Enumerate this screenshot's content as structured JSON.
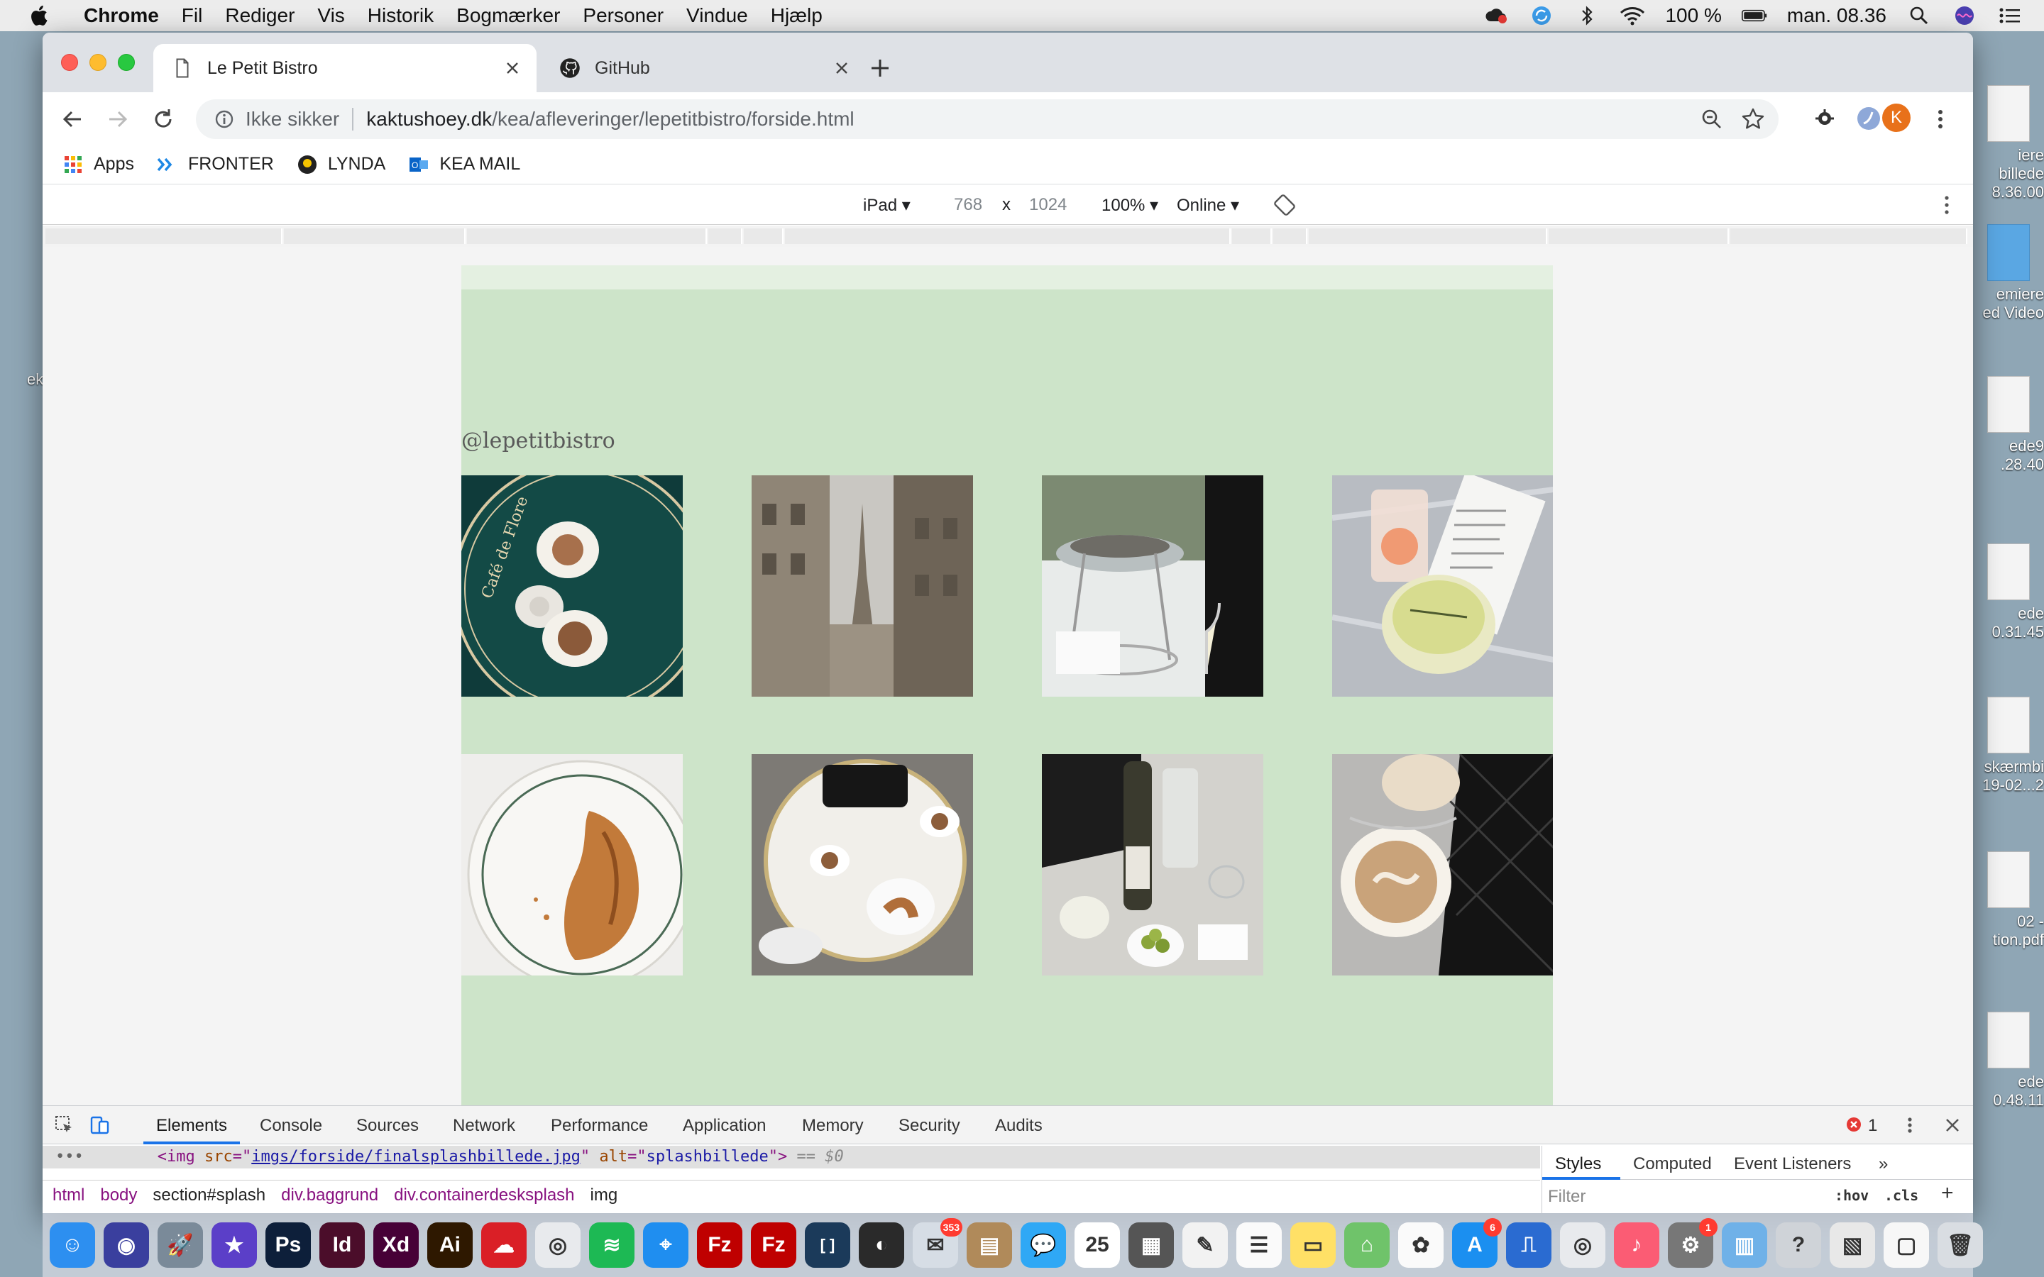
{
  "menubar": {
    "app_name": "Chrome",
    "items": [
      "Fil",
      "Rediger",
      "Vis",
      "Historik",
      "Bogmærker",
      "Personer",
      "Vindue",
      "Hjælp"
    ],
    "battery": "100 %",
    "clock": "man. 08.36"
  },
  "desktop": {
    "items": [
      {
        "label": "iere\nbillede\n8.36.00"
      },
      {
        "label": "emiere\ned Video"
      },
      {
        "label": "ede9\n.28.40"
      },
      {
        "label": "ede\n0.31.45"
      },
      {
        "label": "skærmbi\n19-02...2"
      },
      {
        "label": "02 -\ntion.pdf"
      },
      {
        "label": "ede\n0.48.11"
      }
    ],
    "left_fragment": "ek"
  },
  "browser": {
    "tabs": [
      {
        "title": "Le Petit Bistro",
        "active": true
      },
      {
        "title": "GitHub",
        "active": false
      }
    ],
    "omnibox": {
      "security": "Ikke sikker",
      "host": "kaktushoey.dk",
      "path": "/kea/afleveringer/lepetitbistro/forside.html"
    },
    "profile_initial": "K",
    "bookmarks": [
      {
        "label": "Apps",
        "icon": "apps-grid-icon"
      },
      {
        "label": "FRONTER",
        "icon": "fronter-icon"
      },
      {
        "label": "LYNDA",
        "icon": "lynda-icon"
      },
      {
        "label": "KEA MAIL",
        "icon": "outlook-icon"
      }
    ]
  },
  "device_toolbar": {
    "device": "iPad",
    "width": "768",
    "times": "x",
    "height": "1024",
    "zoom": "100%",
    "network": "Online"
  },
  "page": {
    "background": "#cde4c9",
    "handle": "@lepetitbistro",
    "photos": [
      {
        "name": "cafe-de-flore-table-photo"
      },
      {
        "name": "eiffel-tower-street-photo"
      },
      {
        "name": "oysters-stand-photo"
      },
      {
        "name": "cocktails-menu-photo"
      },
      {
        "name": "croissant-plate-photo"
      },
      {
        "name": "cafe-table-handbag-photo"
      },
      {
        "name": "wine-and-olives-photo"
      },
      {
        "name": "latte-and-quilted-bag-photo"
      }
    ]
  },
  "devtools": {
    "tabs": [
      "Elements",
      "Console",
      "Sources",
      "Network",
      "Performance",
      "Application",
      "Memory",
      "Security",
      "Audits"
    ],
    "error_count": "1",
    "dom": {
      "tag_open": "<img ",
      "src_attr": "src",
      "src_value": "imgs/forside/finalsplashbillede.jpg",
      "alt_attr": "alt",
      "alt_value": "splashbillede",
      "tag_close": ">",
      "selected_marker": "== $0"
    },
    "breadcrumbs": [
      "html",
      "body",
      "section#splash",
      "div.baggrund",
      "div.containerdesksplash",
      "img"
    ],
    "styles_tabs": [
      "Styles",
      "Computed",
      "Event Listeners"
    ],
    "filter_placeholder": "Filter",
    "hov": ":hov",
    "cls": ".cls"
  },
  "dock": {
    "apps": [
      {
        "name": "finder",
        "color": "#2d8ff0",
        "glyph": "☺"
      },
      {
        "name": "siri",
        "color": "#3a3f9e",
        "glyph": "◉"
      },
      {
        "name": "launchpad",
        "color": "#7a8a99",
        "glyph": "🚀"
      },
      {
        "name": "imovie-star",
        "color": "#5b3fc8",
        "glyph": "★"
      },
      {
        "name": "photoshop",
        "color": "#0d1f3a",
        "glyph": "Ps"
      },
      {
        "name": "indesign",
        "color": "#4b0d2a",
        "glyph": "Id"
      },
      {
        "name": "xd",
        "color": "#470137",
        "glyph": "Xd"
      },
      {
        "name": "illustrator",
        "color": "#2e1800",
        "glyph": "Ai"
      },
      {
        "name": "creative-cloud",
        "color": "#da1f26",
        "glyph": "☁"
      },
      {
        "name": "chrome",
        "color": "#e8eaed",
        "glyph": "◎"
      },
      {
        "name": "spotify",
        "color": "#1db954",
        "glyph": "≋"
      },
      {
        "name": "safari",
        "color": "#1f8ef0",
        "glyph": "⌖"
      },
      {
        "name": "filezilla",
        "color": "#bf0000",
        "glyph": "Fz"
      },
      {
        "name": "filezilla-2",
        "color": "#bf0000",
        "glyph": "Fz"
      },
      {
        "name": "brackets",
        "color": "#1b3a5a",
        "glyph": "[ ]"
      },
      {
        "name": "obs",
        "color": "#2a2a2a",
        "glyph": "◐"
      },
      {
        "name": "mail",
        "color": "#d6dde5",
        "glyph": "✉",
        "badge": "353"
      },
      {
        "name": "notes-brown",
        "color": "#b08a5a",
        "glyph": "▤"
      },
      {
        "name": "messages",
        "color": "#2fa8f5",
        "glyph": "💬"
      },
      {
        "name": "calendar",
        "color": "#ffffff",
        "glyph": "25"
      },
      {
        "name": "calculator",
        "color": "#555",
        "glyph": "▦"
      },
      {
        "name": "textedit",
        "color": "#f2f2f2",
        "glyph": "✎"
      },
      {
        "name": "reminders",
        "color": "#fafafa",
        "glyph": "☰"
      },
      {
        "name": "notes",
        "color": "#ffe066",
        "glyph": "▭"
      },
      {
        "name": "maps",
        "color": "#6fc36a",
        "glyph": "⌂"
      },
      {
        "name": "photos",
        "color": "#fafafa",
        "glyph": "✿"
      },
      {
        "name": "app-store",
        "color": "#1b8ff0",
        "glyph": "A",
        "badge": "6"
      },
      {
        "name": "keynote",
        "color": "#2a6bd1",
        "glyph": "⎍"
      },
      {
        "name": "chrome-2",
        "color": "#e8eaed",
        "glyph": "◎"
      },
      {
        "name": "itunes",
        "color": "#fb5c74",
        "glyph": "♪"
      },
      {
        "name": "system-preferences",
        "color": "#777",
        "glyph": "⚙",
        "badge": "1"
      },
      {
        "name": "downloads-folder",
        "color": "#6fb1e8",
        "glyph": "▥"
      },
      {
        "name": "help",
        "color": "#cfd3d8",
        "glyph": "?"
      },
      {
        "name": "preview-file",
        "color": "#e8e8e8",
        "glyph": "▧"
      },
      {
        "name": "screenshot-file",
        "color": "#f7f7f7",
        "glyph": "▢"
      },
      {
        "name": "trash",
        "color": "#d9dde2",
        "glyph": "🗑"
      }
    ]
  }
}
